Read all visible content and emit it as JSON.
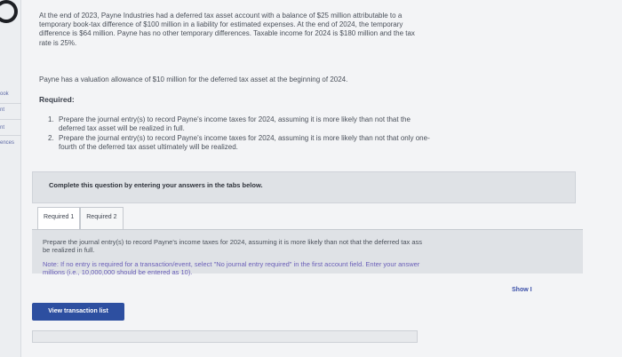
{
  "sidebar": {
    "items": [
      "ook",
      "nt",
      "nt",
      "ences"
    ]
  },
  "problem": {
    "paragraph1_lines": [
      "At the end of 2023, Payne Industries had a deferred tax asset account with a balance of $25 million attributable to a",
      "temporary book-tax difference of $100 million in a liability for estimated expenses. At the end of 2024, the temporary",
      "difference is $64 million. Payne has no other temporary differences. Taxable income for 2024 is $180 million and the tax",
      "rate is 25%."
    ],
    "paragraph2": "Payne has a valuation allowance of $10 million for the deferred tax asset at the beginning of 2024.",
    "required_heading": "Required:",
    "requirements": [
      {
        "num": "1.",
        "lines": [
          "Prepare the journal entry(s) to record Payne's income taxes for 2024, assuming it is more likely than not that the",
          "deferred tax asset will be realized in full."
        ]
      },
      {
        "num": "2.",
        "lines": [
          "Prepare the journal entry(s) to record Payne's income taxes for 2024, assuming it is more likely than not that only one-",
          "fourth of the deferred tax asset ultimately will be realized."
        ]
      }
    ]
  },
  "instruction": "Complete this question by entering your answers in the tabs below.",
  "tabs": [
    {
      "label": "Required 1",
      "active": true
    },
    {
      "label": "Required 2",
      "active": false
    }
  ],
  "panel": {
    "text_lines": [
      "Prepare the journal entry(s) to record Payne's income taxes for 2024, assuming it is more likely than not that the deferred tax ass",
      "be realized in full."
    ],
    "note_lines": [
      "Note: If no entry is required for a transaction/event, select \"No journal entry required\" in the first account field. Enter your answer",
      "millions (i.e., 10,000,000 should be entered as 10)."
    ]
  },
  "show_label": "Show I",
  "view_transaction_label": "View transaction list",
  "colors": {
    "accent": "#2d4fa0",
    "note": "#6a5fb8",
    "panel_bg": "#dfe2e6"
  }
}
